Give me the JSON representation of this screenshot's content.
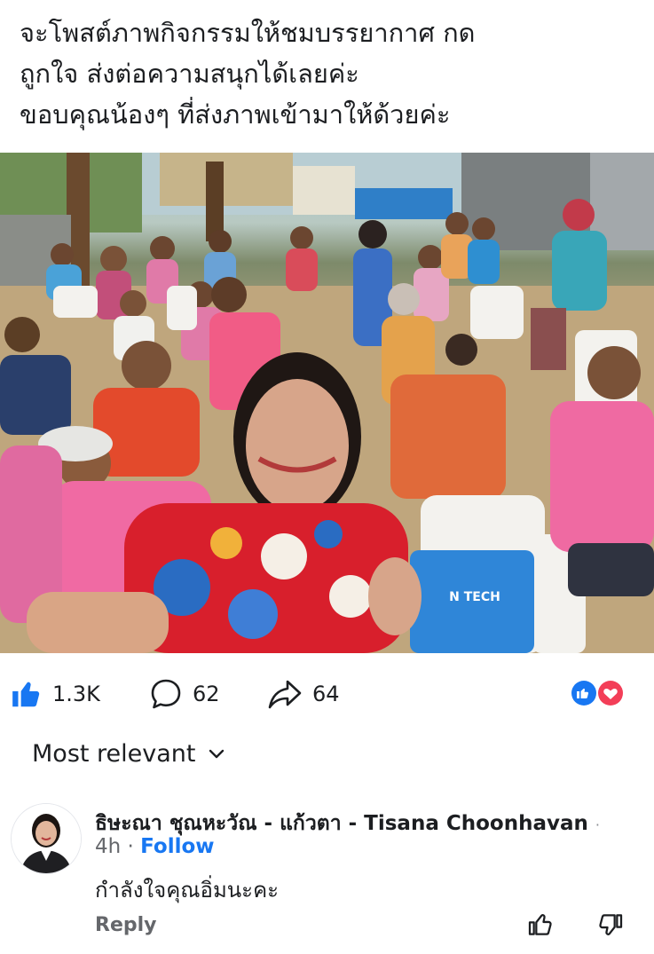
{
  "post": {
    "text": "จะโพสต์ภาพกิจกรรมให้ชมบรรยากาศ กด\nถูกใจ ส่งต่อความสนุกได้เลยค่ะ\nขอบคุณน้องๆ ที่ส่งภาพเข้ามาให้ด้วยค่ะ",
    "photo_bag_text": "N TECH"
  },
  "engagement": {
    "likes": "1.3K",
    "comments": "62",
    "shares": "64",
    "reaction_icons": [
      "like-reaction-icon",
      "love-reaction-icon"
    ],
    "like_color": "#1877f2",
    "love_color": "#f33e58"
  },
  "comments_section": {
    "sort_label": "Most relevant",
    "comment": {
      "author": "ธิษะณา ชุณหะวัณ - แก้วตา - Tisana Choonhavan",
      "separator": "·",
      "time": "4h",
      "dot": "·",
      "follow_label": "Follow",
      "text": "กำลังใจคุณอิ่มนะคะ",
      "reply_label": "Reply"
    }
  }
}
